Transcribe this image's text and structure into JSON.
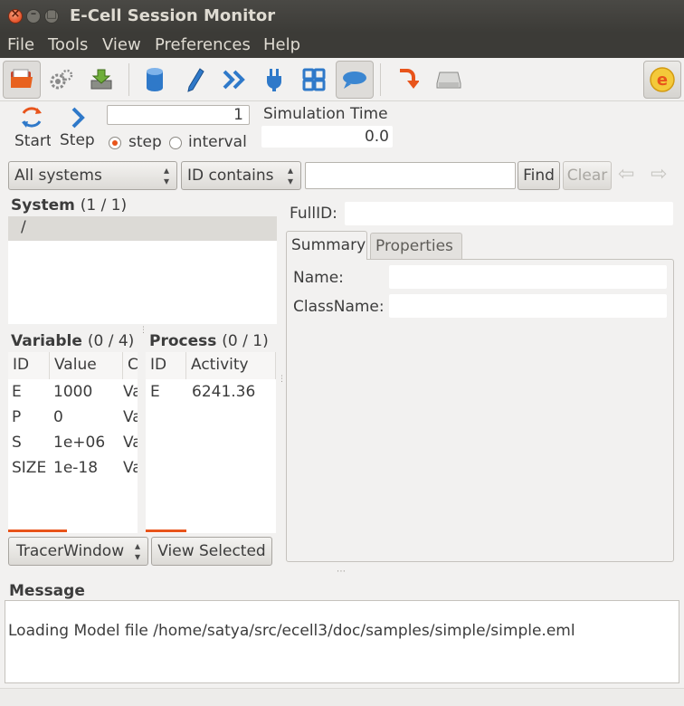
{
  "window": {
    "title": "E-Cell Session Monitor"
  },
  "menu": [
    "File",
    "Tools",
    "View",
    "Preferences",
    "Help"
  ],
  "toolbar": {
    "icons": [
      "open-folder-icon",
      "gears-icon",
      "download-icon",
      "cylinder-icon",
      "pen-icon",
      "double-chevron-icon",
      "plug-icon",
      "grid-icon",
      "speech-bubble-icon",
      "return-arrow-icon",
      "disk-icon",
      "ecell-logo-icon"
    ]
  },
  "controls": {
    "start_label": "Start",
    "step_label": "Step",
    "step_value": "1",
    "radio_step": "step",
    "radio_interval": "interval",
    "sim_time_label": "Simulation Time",
    "sim_time_value": "0.0"
  },
  "search": {
    "system_filter": "All systems",
    "id_filter": "ID contains",
    "query": "",
    "find_label": "Find",
    "clear_label": "Clear"
  },
  "system_panel": {
    "title": "System",
    "count": "(1 / 1)",
    "items": [
      "/"
    ]
  },
  "variable_panel": {
    "title": "Variable",
    "count": "(0 / 4)",
    "columns": [
      "ID",
      "Value",
      "Cl"
    ],
    "rows": [
      [
        "E",
        "1000",
        "Va"
      ],
      [
        "P",
        "0",
        "Va"
      ],
      [
        "S",
        "1e+06",
        "Va"
      ],
      [
        "SIZE",
        "1e-18",
        "Va"
      ]
    ]
  },
  "process_panel": {
    "title": "Process",
    "count": "(0 / 1)",
    "columns": [
      "ID",
      "Activity"
    ],
    "rows": [
      [
        "E",
        "6241.36"
      ]
    ]
  },
  "bottom_buttons": {
    "tracer": "TracerWindow",
    "view_selected": "View Selected"
  },
  "details": {
    "fullid_label": "FullID:",
    "fullid_value": "",
    "tabs": [
      "Summary",
      "Properties"
    ],
    "name_label": "Name:",
    "name_value": "",
    "classname_label": "ClassName:",
    "classname_value": ""
  },
  "message": {
    "title": "Message",
    "text": "Loading Model file /home/satya/src/ecell3/doc/samples/simple/simple.eml"
  },
  "colors": {
    "accent": "#e8541b",
    "titlebar": "#3c3b37"
  }
}
